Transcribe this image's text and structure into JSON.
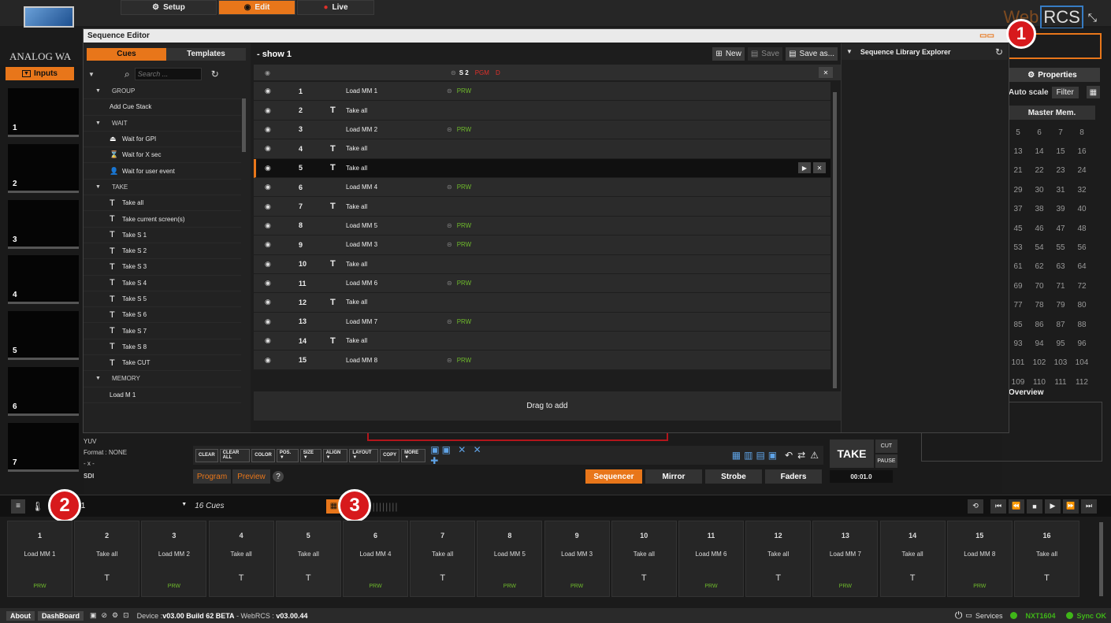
{
  "top": {
    "logo_text": "ANALOG WA",
    "tabs": [
      {
        "label": "Setup",
        "icon": "gear-icon"
      },
      {
        "label": "Edit",
        "icon": "play-circle-icon"
      },
      {
        "label": "Live",
        "icon": "record-icon"
      }
    ],
    "brand": "Web",
    "brand_box": "RCS",
    "collapse_icon": "collapse-icon"
  },
  "left": {
    "inputs_label": "Inputs",
    "thumbs": [
      "1",
      "2",
      "3",
      "4",
      "5",
      "6",
      "7"
    ]
  },
  "seq": {
    "title": "Sequence Editor",
    "tabs": [
      "Cues",
      "Templates"
    ],
    "search_placeholder": "Search ...",
    "cue_list": [
      {
        "label": "GROUP",
        "kind": "group"
      },
      {
        "label": "Add Cue Stack",
        "kind": "item",
        "icon": ""
      },
      {
        "label": "WAIT",
        "kind": "group"
      },
      {
        "label": "Wait for GPI",
        "kind": "item",
        "icon": "gpi-icon"
      },
      {
        "label": "Wait for X sec",
        "kind": "item",
        "icon": "hourglass-icon"
      },
      {
        "label": "Wait for user event",
        "kind": "item",
        "icon": "user-icon"
      },
      {
        "label": "TAKE",
        "kind": "group"
      },
      {
        "label": "Take all",
        "kind": "item",
        "icon": "T"
      },
      {
        "label": "Take current screen(s)",
        "kind": "item",
        "icon": "T"
      },
      {
        "label": "Take S 1",
        "kind": "item",
        "icon": "T"
      },
      {
        "label": "Take S 2",
        "kind": "item",
        "icon": "T"
      },
      {
        "label": "Take S 3",
        "kind": "item",
        "icon": "T"
      },
      {
        "label": "Take S 4",
        "kind": "item",
        "icon": "T"
      },
      {
        "label": "Take S 5",
        "kind": "item",
        "icon": "T"
      },
      {
        "label": "Take S 6",
        "kind": "item",
        "icon": "T"
      },
      {
        "label": "Take S 7",
        "kind": "item",
        "icon": "T"
      },
      {
        "label": "Take S 8",
        "kind": "item",
        "icon": "T"
      },
      {
        "label": "Take CUT",
        "kind": "item",
        "icon": "T"
      },
      {
        "label": "MEMORY",
        "kind": "group"
      },
      {
        "label": "Load M 1",
        "kind": "item",
        "icon": ""
      }
    ],
    "show_name": "- show 1",
    "new_label": "New",
    "save_label": "Save",
    "saveas_label": "Save as...",
    "library_title": "Sequence Library Explorer",
    "header_links": {
      "s2": "S 2",
      "pgm": "PGM",
      "d": "D"
    },
    "rows": [
      {
        "n": "1",
        "t": "",
        "label": "Load MM 1",
        "prw": "PRW"
      },
      {
        "n": "2",
        "t": "T",
        "label": "Take all",
        "prw": ""
      },
      {
        "n": "3",
        "t": "",
        "label": "Load MM 2",
        "prw": "PRW"
      },
      {
        "n": "4",
        "t": "T",
        "label": "Take all",
        "prw": ""
      },
      {
        "n": "5",
        "t": "T",
        "label": "Take all",
        "prw": ""
      },
      {
        "n": "6",
        "t": "",
        "label": "Load MM 4",
        "prw": "PRW"
      },
      {
        "n": "7",
        "t": "T",
        "label": "Take all",
        "prw": ""
      },
      {
        "n": "8",
        "t": "",
        "label": "Load MM 5",
        "prw": "PRW"
      },
      {
        "n": "9",
        "t": "",
        "label": "Load MM 3",
        "prw": "PRW"
      },
      {
        "n": "10",
        "t": "T",
        "label": "Take all",
        "prw": ""
      },
      {
        "n": "11",
        "t": "",
        "label": "Load MM 6",
        "prw": "PRW"
      },
      {
        "n": "12",
        "t": "T",
        "label": "Take all",
        "prw": ""
      },
      {
        "n": "13",
        "t": "",
        "label": "Load MM 7",
        "prw": "PRW"
      },
      {
        "n": "14",
        "t": "T",
        "label": "Take all",
        "prw": ""
      },
      {
        "n": "15",
        "t": "",
        "label": "Load MM 8",
        "prw": "PRW"
      }
    ],
    "drag_hint": "Drag to add"
  },
  "right": {
    "properties_label": "Properties",
    "autoscale_label": "Auto scale",
    "filter_label": "Filter",
    "master_mem_label": "Master Mem.",
    "mem_rows": [
      [
        "5",
        "6",
        "7",
        "8"
      ],
      [
        "13",
        "14",
        "15",
        "16"
      ],
      [
        "21",
        "22",
        "23",
        "24"
      ],
      [
        "29",
        "30",
        "31",
        "32"
      ],
      [
        "37",
        "38",
        "39",
        "40"
      ],
      [
        "45",
        "46",
        "47",
        "48"
      ],
      [
        "53",
        "54",
        "55",
        "56"
      ],
      [
        "61",
        "62",
        "63",
        "64"
      ],
      [
        "69",
        "70",
        "71",
        "72"
      ],
      [
        "77",
        "78",
        "79",
        "80"
      ],
      [
        "85",
        "86",
        "87",
        "88"
      ],
      [
        "93",
        "94",
        "95",
        "96"
      ],
      [
        "101",
        "102",
        "103",
        "104"
      ],
      [
        "109",
        "110",
        "111",
        "112"
      ]
    ],
    "overview_label": "Overview"
  },
  "bottom_tools": {
    "yuv": "YUV",
    "format": "Format : NONE",
    "x": "- x -",
    "sdi": "SDI",
    "buttons": [
      "CLEAR",
      "CLEAR ALL",
      "COLOR",
      "POS. ▼",
      "SIZE ▼",
      "ALIGN ▼",
      "LAYOUT ▼",
      "COPY",
      "MORE ▼"
    ],
    "program": "Program",
    "preview": "Preview",
    "help": "?",
    "modes": [
      "Sequencer",
      "Mirror",
      "Strobe",
      "Faders"
    ],
    "take": "TAKE",
    "cut": "CUT",
    "pause": "PAUSE",
    "duration": "00:01.0"
  },
  "cuebar": {
    "show_select": "ow 1",
    "count": "16 Cues",
    "badge1": "1",
    "badge2": "2",
    "badge3": "3"
  },
  "cues": [
    {
      "n": "1",
      "label": "Load MM 1",
      "foot": "PRW"
    },
    {
      "n": "2",
      "label": "Take all",
      "foot": "T"
    },
    {
      "n": "3",
      "label": "Load MM 2",
      "foot": "PRW"
    },
    {
      "n": "4",
      "label": "Take all",
      "foot": "T"
    },
    {
      "n": "5",
      "label": "Take all",
      "foot": "T"
    },
    {
      "n": "6",
      "label": "Load MM 4",
      "foot": "PRW"
    },
    {
      "n": "7",
      "label": "Take all",
      "foot": "T"
    },
    {
      "n": "8",
      "label": "Load MM 5",
      "foot": "PRW"
    },
    {
      "n": "9",
      "label": "Load MM 3",
      "foot": "PRW"
    },
    {
      "n": "10",
      "label": "Take all",
      "foot": "T"
    },
    {
      "n": "11",
      "label": "Load MM 6",
      "foot": "PRW"
    },
    {
      "n": "12",
      "label": "Take all",
      "foot": "T"
    },
    {
      "n": "13",
      "label": "Load MM 7",
      "foot": "PRW"
    },
    {
      "n": "14",
      "label": "Take all",
      "foot": "T"
    },
    {
      "n": "15",
      "label": "Load MM 8",
      "foot": "PRW"
    },
    {
      "n": "16",
      "label": "Take all",
      "foot": "T"
    }
  ],
  "status": {
    "about": "About",
    "dashboard": "DashBoard",
    "device_prefix": "Device : ",
    "device_ver": "v03.00 Build 62 BETA",
    "webrcs_prefix": " - WebRCS : ",
    "webrcs_ver": "v03.00.44",
    "services": "Services",
    "unit": "NXT1604",
    "sync": "Sync OK"
  },
  "colors": {
    "accent": "#e8761a",
    "prw": "#6fba2c",
    "badge": "#d7191c",
    "pgm": "#e0302a"
  }
}
